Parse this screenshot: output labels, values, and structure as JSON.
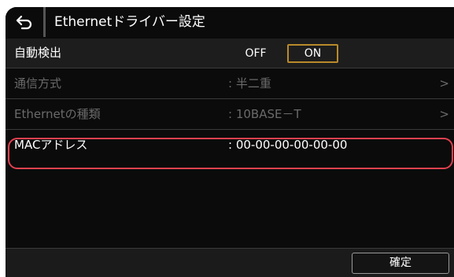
{
  "header": {
    "back_icon": "return-arrow-icon",
    "title": "Ethernetドライバー設定"
  },
  "rows": {
    "auto_detect": {
      "label": "自動検出",
      "off_label": "OFF",
      "on_label": "ON",
      "selected": "ON"
    },
    "comm_mode": {
      "label": "通信方式",
      "value": ": 半二重",
      "chevron": ">"
    },
    "ethernet_type": {
      "label": "Ethernetの種類",
      "value": ": 10BASE－T",
      "chevron": ">"
    },
    "mac_address": {
      "label": "MACアドレス",
      "value": ": 00-00-00-00-00-00"
    }
  },
  "footer": {
    "confirm_label": "確定"
  },
  "colors": {
    "background": "#0b0b0b",
    "selected_border": "#b98a2a",
    "highlight_outline": "#e0414f",
    "disabled_text": "#6a6a6a"
  }
}
